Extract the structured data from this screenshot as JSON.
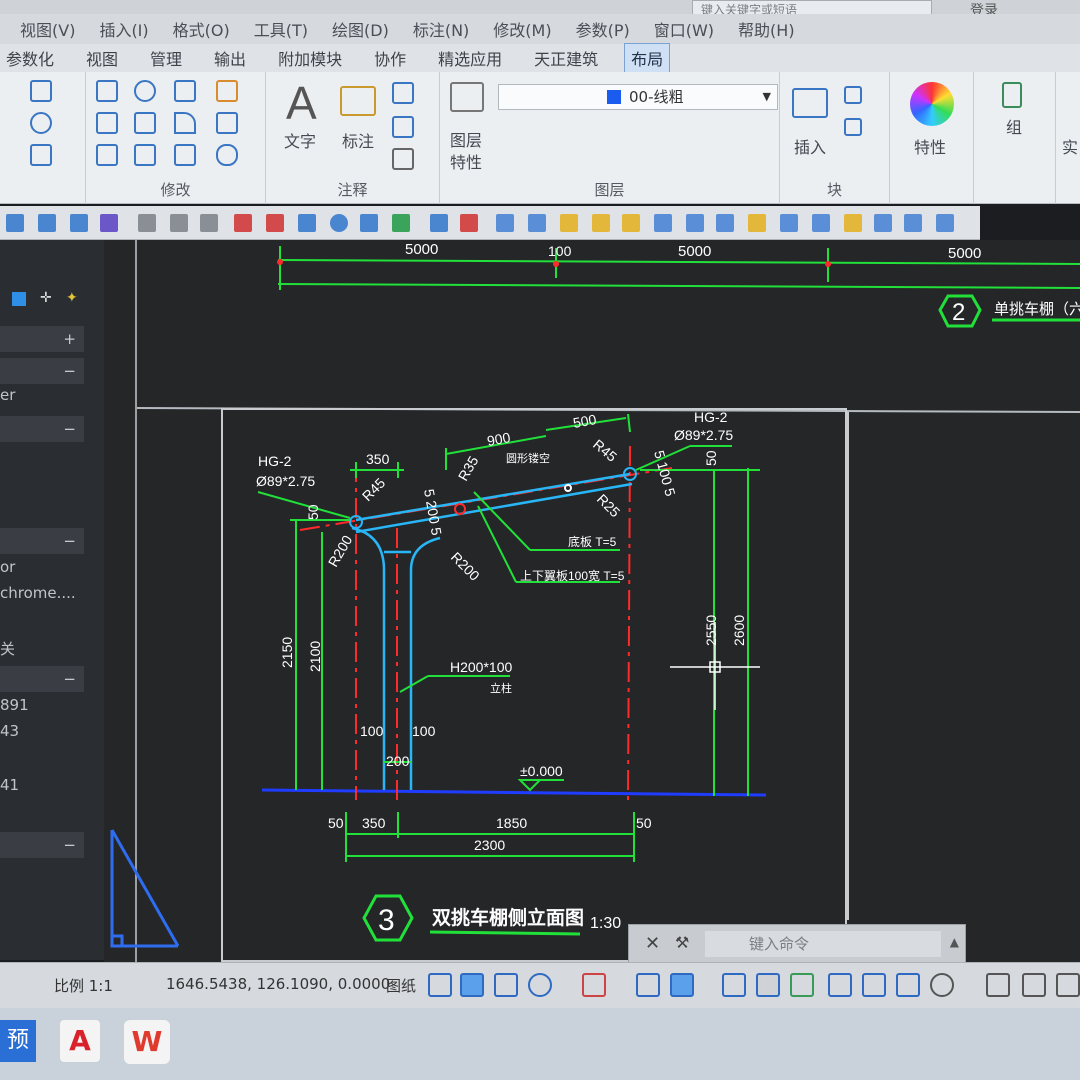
{
  "titlebar": {
    "search_placeholder": "键入关键字或短语",
    "login": "登录"
  },
  "menubar": {
    "items": [
      "视图(V)",
      "插入(I)",
      "格式(O)",
      "工具(T)",
      "绘图(D)",
      "标注(N)",
      "修改(M)",
      "参数(P)",
      "窗口(W)",
      "帮助(H)"
    ]
  },
  "tabs": {
    "items": [
      "参数化",
      "视图",
      "管理",
      "输出",
      "附加模块",
      "协作",
      "精选应用",
      "天正建筑",
      "布局"
    ],
    "active": "布局"
  },
  "ribbon": {
    "modify_label": "修改",
    "text_label": "文字",
    "dimension_label": "标注",
    "annotation_label": "注释",
    "layer_props_label": "图层特性",
    "layer_name": "00-线粗",
    "layers_label": "图层",
    "insert_label": "插入",
    "block_label": "块",
    "properties_label": "特性",
    "group_label": "组",
    "practical_label": "实"
  },
  "left_palette": {
    "items": [
      "er",
      "or",
      "chrome....",
      "关",
      "891",
      "43",
      "41"
    ]
  },
  "drawing": {
    "top_dims": [
      "5000",
      "100",
      "5000",
      "5000"
    ],
    "view2_number": "2",
    "view2_title": "单挑车棚（六个",
    "view3_number": "3",
    "view3_title": "双挑车棚侧立面图",
    "view3_scale": "1:30",
    "labels": {
      "hg2_left": "HG-2",
      "pipe_left": "Ø89*2.75",
      "hg2_right": "HG-2",
      "pipe_right": "Ø89*2.75",
      "dim_350_top": "350",
      "dim_900": "900",
      "dim_500": "500",
      "r45_left": "R45",
      "r45_right": "R45",
      "r35": "R35",
      "r25": "R25",
      "r200_left": "R200",
      "r200_right": "R200",
      "dim_5_200_5": "5 200 5",
      "dim_5_100_5": "5 100 5",
      "dim_50_top_left": "50",
      "dim_50_top_right": "50",
      "arc_note": "圆形镂空",
      "plate_note": "底板 T=5",
      "wing_note": "上下翼板100宽 T=5",
      "column_size": "H200*100",
      "column_name": "立柱",
      "dim_2150": "2150",
      "dim_2100": "2100",
      "dim_2550": "2550",
      "dim_2600": "2600",
      "dim_100_left": "100",
      "dim_100_right": "100",
      "dim_200": "200",
      "level": "±0.000",
      "dim_50_bottom_left": "50",
      "dim_350_bottom": "350",
      "dim_1850": "1850",
      "dim_50_bottom_right": "50",
      "dim_2300": "2300"
    }
  },
  "command": {
    "placeholder": "键入命令"
  },
  "statusbar": {
    "scale": "比例 1:1",
    "coordinates": "1646.5438, 126.1090, 0.0000",
    "paper": "图纸"
  },
  "taskbar": {
    "preview_label": "预",
    "autocad_label": "A",
    "wps_label": "W"
  },
  "colors": {
    "dimension": "#22e03a",
    "centerline": "#ff2a2a",
    "steel": "#29b6f6",
    "ground": "#1f3cff",
    "text": "#ffffff",
    "canvas": "#242628"
  }
}
